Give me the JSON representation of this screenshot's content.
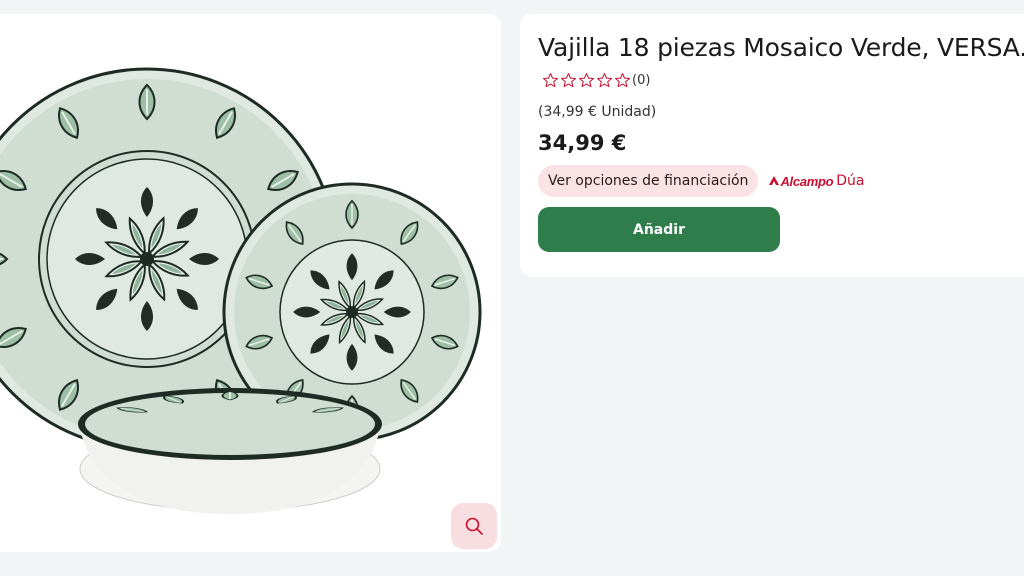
{
  "product": {
    "title": "Vajilla 18 piezas Mosaico Verde, VERSA.",
    "rating_count": "(0)",
    "rating_value": 0,
    "rating_max": 5,
    "unit_price": "(34,99 € Unidad)",
    "price": "34,99 €"
  },
  "actions": {
    "financing_label": "Ver opciones de financiación",
    "add_label": "Añadir"
  },
  "brand": {
    "logo_text": "Alcampo",
    "suffix": "Dúa"
  },
  "icons": {
    "zoom": "search-icon",
    "star": "star-outline-icon"
  },
  "colors": {
    "accent_green": "#2f7d4a",
    "brand_red": "#c8102e",
    "finance_bg": "#fbe3e5",
    "zoom_bg": "#f8dde1"
  }
}
